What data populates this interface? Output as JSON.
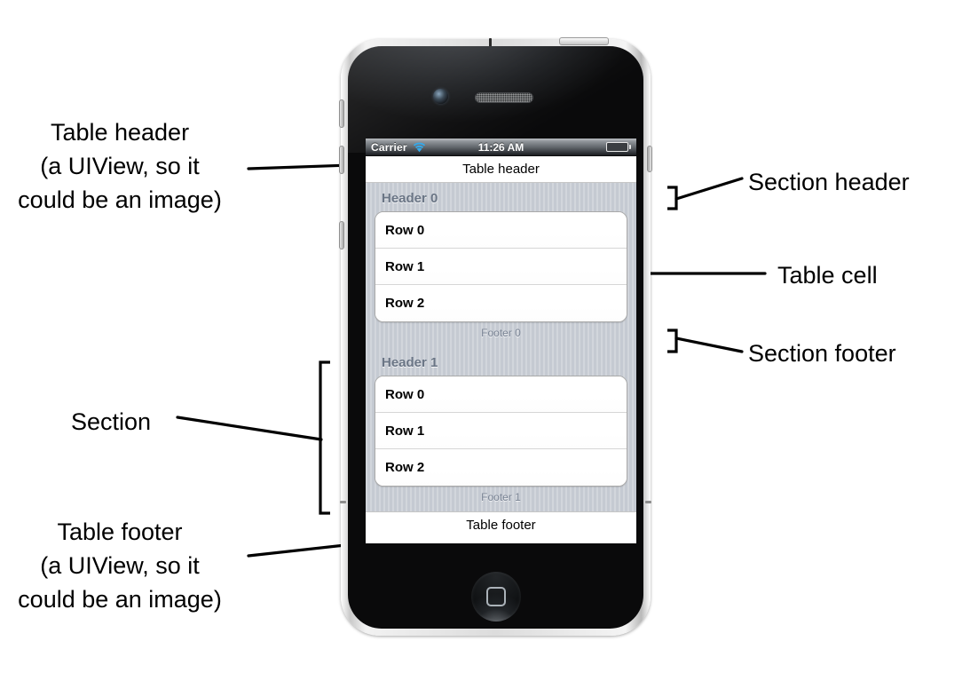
{
  "annotations": {
    "table_header": "Table header\n(a UIView, so it\ncould be an image)",
    "table_footer": "Table footer\n(a UIView, so it\ncould be an image)",
    "section": "Section",
    "section_header": "Section header",
    "table_cell": "Table cell",
    "section_footer": "Section footer"
  },
  "device": {
    "icons": {
      "camera": "front-camera-icon",
      "speaker": "earpiece-speaker-icon",
      "home": "home-button-icon"
    }
  },
  "screen": {
    "status_bar": {
      "carrier": "Carrier",
      "wifi_icon": "wifi-icon",
      "time": "11:26 AM",
      "battery_icon": "battery-icon"
    },
    "table_header_label": "Table header",
    "table_footer_label": "Table footer",
    "sections": [
      {
        "header": "Header 0",
        "footer": "Footer 0",
        "rows": [
          "Row 0",
          "Row 1",
          "Row 2"
        ]
      },
      {
        "header": "Header 1",
        "footer": "Footer 1",
        "rows": [
          "Row 0",
          "Row 1",
          "Row 2"
        ]
      }
    ]
  },
  "colors": {
    "page_background": "#ffffff",
    "annotation_text": "#000000",
    "table_background": "#c5cad2",
    "section_header_text": "#6a7585",
    "section_footer_text": "#7a8494",
    "cell_text": "#000000",
    "battery_green": "#6fc82e"
  }
}
